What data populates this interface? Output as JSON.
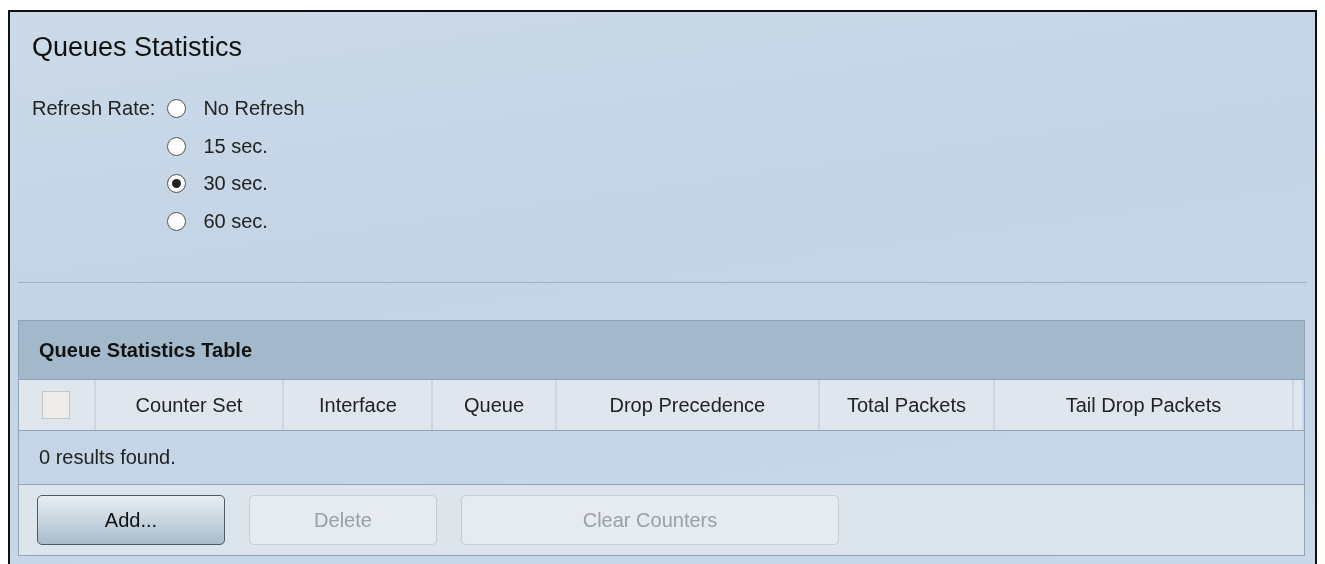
{
  "page": {
    "title": "Queues Statistics"
  },
  "refresh_rate": {
    "label": "Refresh Rate:",
    "options": [
      {
        "label": "No Refresh",
        "selected": false
      },
      {
        "label": "15 sec.",
        "selected": false
      },
      {
        "label": "30 sec.",
        "selected": true
      },
      {
        "label": "60 sec.",
        "selected": false
      }
    ]
  },
  "table": {
    "title": "Queue Statistics Table",
    "select_all": {
      "checked": false
    },
    "columns": [
      "Counter Set",
      "Interface",
      "Queue",
      "Drop Precedence",
      "Total Packets",
      "Tail Drop Packets"
    ],
    "status": "0 results found.",
    "buttons": [
      {
        "label": "Add...",
        "disabled": false
      },
      {
        "label": "Delete",
        "disabled": true
      },
      {
        "label": "Clear Counters",
        "disabled": true
      }
    ]
  }
}
